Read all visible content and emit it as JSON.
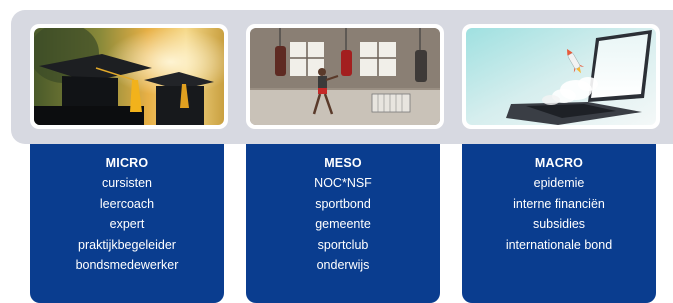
{
  "columns": [
    {
      "title": "MICRO",
      "items": [
        "cursisten",
        "leercoach",
        "expert",
        "praktijkbegeleider",
        "bondsmedewerker"
      ],
      "image": "graduation-caps-photo"
    },
    {
      "title": "MESO",
      "items": [
        "NOC*NSF",
        "sportbond",
        "gemeente",
        "sportclub",
        "onderwijs"
      ],
      "image": "boxing-gym-photo"
    },
    {
      "title": "MACRO",
      "items": [
        "epidemie",
        "interne financiën",
        "subsidies",
        "internationale bond"
      ],
      "image": "laptop-rocket-photo"
    }
  ],
  "colors": {
    "card_blue": "#0a3d8f",
    "band_grey": "#d7d9e1"
  }
}
